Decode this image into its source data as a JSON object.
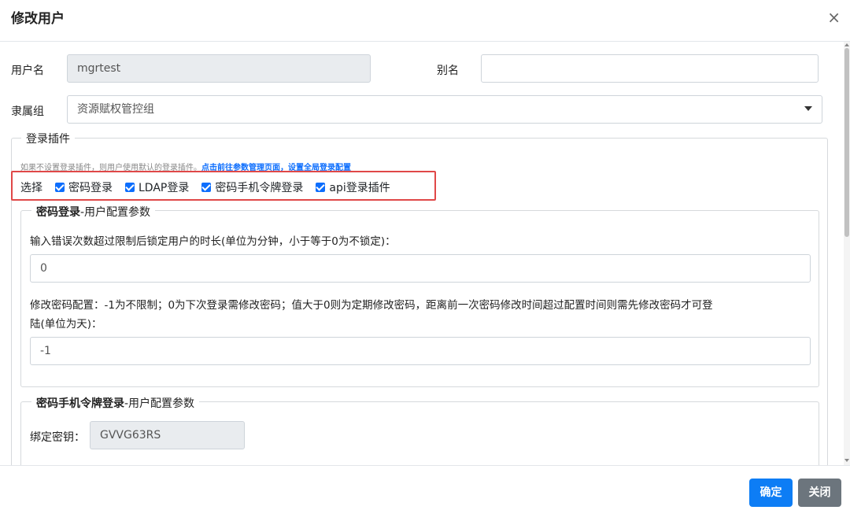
{
  "dialog": {
    "title": "修改用户",
    "close_glyph": "×"
  },
  "form": {
    "username_label": "用户名",
    "username_value": "mgrtest",
    "alias_label": "别名",
    "alias_value": "",
    "group_label": "隶属组",
    "group_value": "资源赋权管控组"
  },
  "login_plugins": {
    "legend": "登录插件",
    "hint_text": "如果不设置登录插件，则用户使用默认的登录插件。",
    "hint_link1": "点击前往参数管理页面，设置全局登录配置",
    "select_label": "选择",
    "options": [
      {
        "label": "密码登录",
        "checked": true
      },
      {
        "label": "LDAP登录",
        "checked": true
      },
      {
        "label": "密码手机令牌登录",
        "checked": true
      },
      {
        "label": "api登录插件",
        "checked": true
      }
    ]
  },
  "password_login": {
    "legend_bold": "密码登录",
    "legend_rest": "-用户配置参数",
    "lock_label": "输入错误次数超过限制后锁定用户的时长(单位为分钟，小于等于0为不锁定)：",
    "lock_value": "0",
    "change_label_line1": "修改密码配置：-1为不限制；0为下次登录需修改密码；值大于0则为定期修改密码，距离前一次密码修改时间超过配置时间则需先修改密码才可登",
    "change_label_line2": "陆(单位为天)：",
    "change_value": "-1"
  },
  "token_login": {
    "legend_bold": "密码手机令牌登录",
    "legend_rest": "-用户配置参数",
    "bind_label": "绑定密钥：",
    "bind_value": "GVVG63RS"
  },
  "footer": {
    "ok_label": "确定",
    "close_label": "关闭"
  },
  "colors": {
    "primary": "#0d7df5",
    "secondary": "#6c757d",
    "highlight_box": "#e04848"
  }
}
